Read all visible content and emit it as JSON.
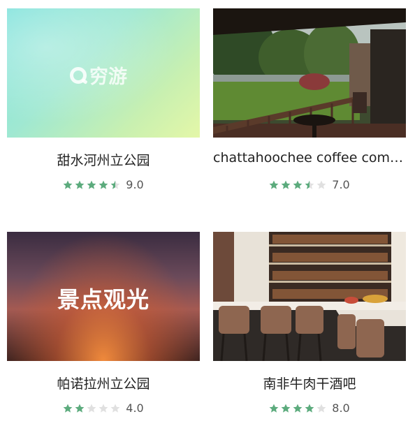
{
  "places": [
    {
      "title": "甜水河州立公园",
      "rating_stars": 4.5,
      "score": "9.0",
      "image": {
        "type": "placeholder-logo",
        "logo_text": "穷游"
      }
    },
    {
      "title": "chattahoochee coffee comp…",
      "rating_stars": 3.5,
      "score": "7.0",
      "image": {
        "type": "photo-terrace"
      }
    },
    {
      "title": "帕诺拉州立公园",
      "rating_stars": 2,
      "score": "4.0",
      "image": {
        "type": "placeholder-text",
        "overlay_text": "景点观光"
      }
    },
    {
      "title": "南非牛肉干酒吧",
      "rating_stars": 4,
      "score": "8.0",
      "image": {
        "type": "photo-bar"
      }
    }
  ],
  "colors": {
    "star_filled": "#5cab7d",
    "star_empty": "#e0e0e0"
  }
}
